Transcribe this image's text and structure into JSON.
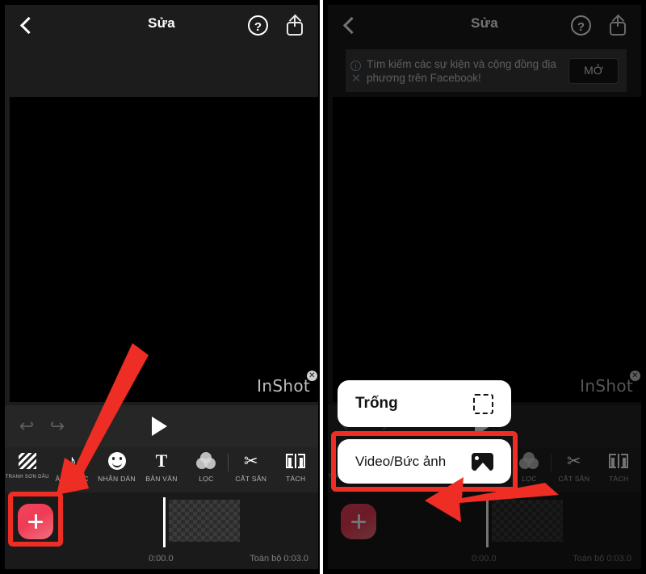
{
  "app": {
    "watermark": "InShot",
    "watermark_badge": "✕"
  },
  "colors": {
    "accent_red": "#ee2d24",
    "add_button": "#f2455e",
    "panel_bg": "#1c1c1c",
    "toolbar_bg": "#222222",
    "canvas_bg": "#000000",
    "popup_bg": "#ffffff"
  },
  "header": {
    "title": "Sửa",
    "back_icon": "chevron-left-icon",
    "help_label": "?",
    "help_icon": "question-circle-icon",
    "share_icon": "share-icon"
  },
  "banner": {
    "text": "Tìm kiếm các sự kiện và cộng đồng địa phương trên Facebook!",
    "button_label": "MỞ",
    "info_label": "i",
    "close_label": "✕"
  },
  "playback": {
    "undo_icon": "undo-arrow-icon",
    "undo_label": "↩",
    "redo_icon": "redo-arrow-icon",
    "redo_label": "↪",
    "play_icon": "play-triangle-icon"
  },
  "toolbar": {
    "items": [
      {
        "label": "TRANH SƠN DẦU",
        "icon": "canvas-hatch-icon"
      },
      {
        "label": "ÂM NHẠC",
        "icon": "music-note-icon",
        "glyph": "♪"
      },
      {
        "label": "NHÃN DÁN",
        "icon": "sticker-smiley-icon"
      },
      {
        "label": "BẢN VĂN",
        "icon": "text-t-icon",
        "glyph": "T"
      },
      {
        "label": "LỌC",
        "icon": "filter-circles-icon"
      },
      {
        "label": "CẮT SẮN",
        "icon": "scissors-icon",
        "glyph": "✂"
      },
      {
        "label": "TÁCH",
        "icon": "split-clip-icon"
      }
    ]
  },
  "timeline": {
    "add_icon": "plus-icon",
    "current_time": "0:00.0",
    "total_label": "Toàn bộ 0:03.0"
  },
  "popup": {
    "items": [
      {
        "label": "Trống",
        "icon": "dashed-square-icon"
      },
      {
        "label": "Video/Bức ảnh",
        "icon": "photo-icon"
      }
    ]
  }
}
